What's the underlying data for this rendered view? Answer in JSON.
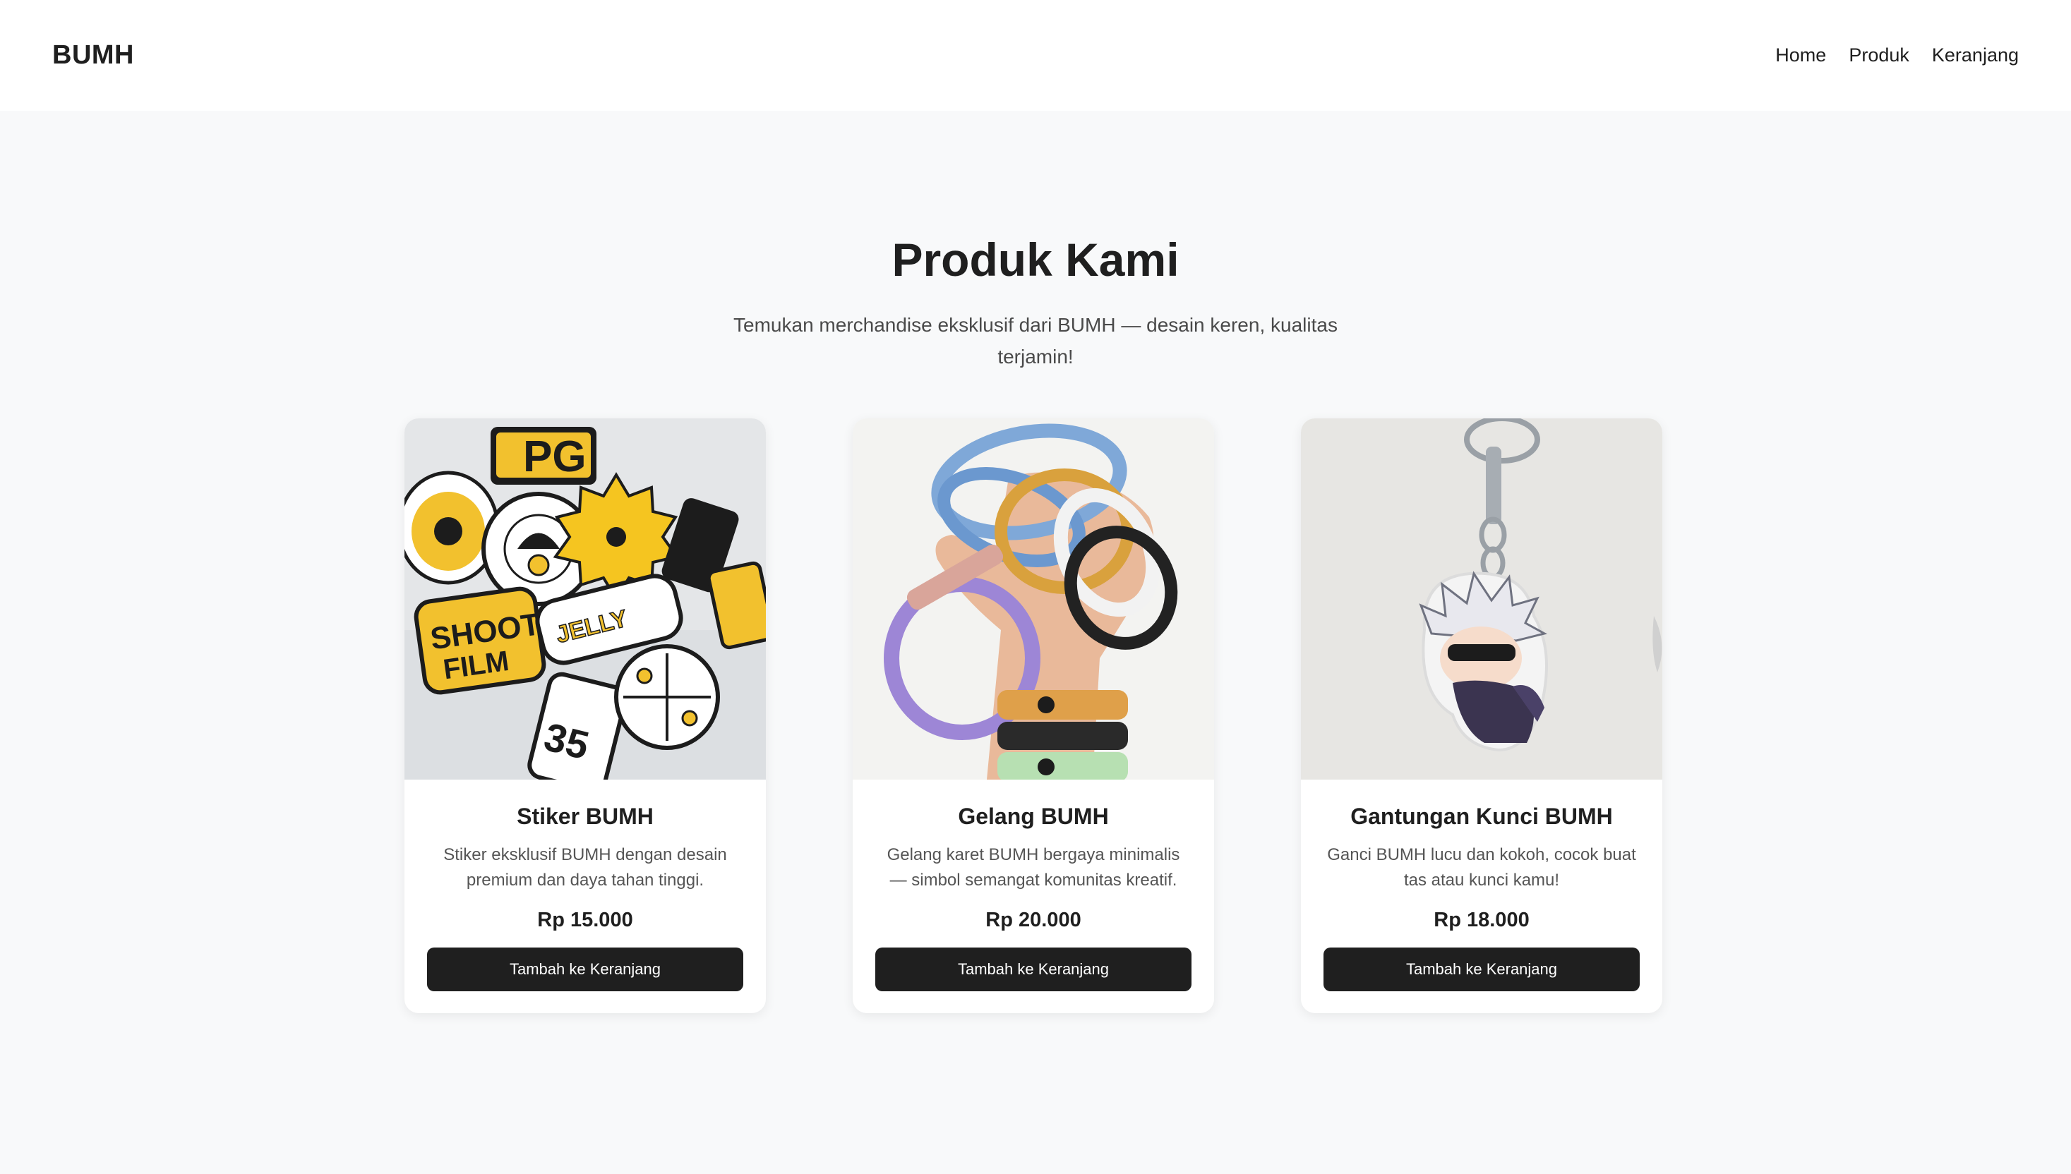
{
  "nav": {
    "brand": "BUMH",
    "links": [
      {
        "label": "Home"
      },
      {
        "label": "Produk"
      },
      {
        "label": "Keranjang"
      }
    ]
  },
  "hero": {
    "title": "Produk Kami",
    "subtitle": "Temukan merchandise eksklusif dari BUMH — desain keren, kualitas terjamin!"
  },
  "products": [
    {
      "name": "Stiker BUMH",
      "description": "Stiker eksklusif BUMH dengan desain premium dan daya tahan tinggi.",
      "price": "Rp 15.000",
      "button": "Tambah ke Keranjang",
      "image": "sticker-pack-photo"
    },
    {
      "name": "Gelang BUMH",
      "description": "Gelang karet BUMH bergaya minimalis — simbol semangat komunitas kreatif.",
      "price": "Rp 20.000",
      "button": "Tambah ke Keranjang",
      "image": "rubber-bracelets-photo"
    },
    {
      "name": "Gantungan Kunci BUMH",
      "description": "Ganci BUMH lucu dan kokoh, cocok buat tas atau kunci kamu!",
      "price": "Rp 18.000",
      "button": "Tambah ke Keranjang",
      "image": "acrylic-keychain-photo"
    }
  ]
}
